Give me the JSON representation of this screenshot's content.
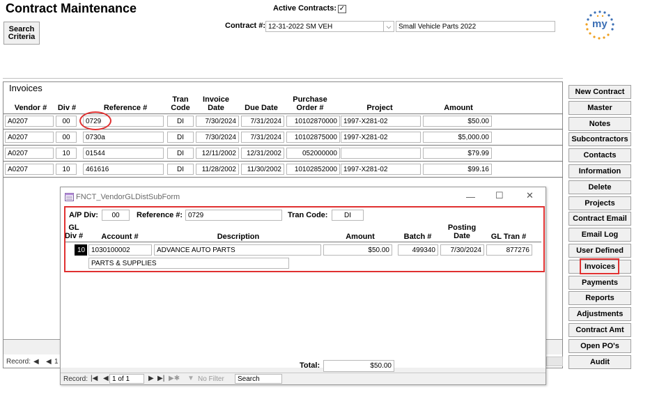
{
  "title": "Contract Maintenance",
  "search_criteria_label": "Search\nCriteria",
  "active_contracts_label": "Active Contracts:",
  "active_contracts_checked": "✓",
  "contract_label": "Contract #:",
  "contract_value": "12-31-2022 SM VEH",
  "contract_description": "Small Vehicle Parts 2022",
  "logo_text": "my",
  "invoices": {
    "section_title": "Invoices",
    "columns": {
      "vendor": "Vendor #",
      "div": "Div #",
      "reference": "Reference #",
      "tran_code": "Tran\nCode",
      "invoice_date": "Invoice\nDate",
      "due_date": "Due Date",
      "po": "Purchase\nOrder #",
      "project": "Project",
      "amount": "Amount"
    },
    "rows": [
      {
        "vendor": "A0207",
        "div": "00",
        "reference": "0729",
        "tran_code": "DI",
        "invoice_date": "7/30/2024",
        "due_date": "7/31/2024",
        "po": "10102870000",
        "project": "1997-X281-02",
        "amount": "$50.00"
      },
      {
        "vendor": "A0207",
        "div": "00",
        "reference": "0730a",
        "tran_code": "DI",
        "invoice_date": "7/30/2024",
        "due_date": "7/31/2024",
        "po": "10102875000",
        "project": "1997-X281-02",
        "amount": "$5,000.00"
      },
      {
        "vendor": "A0207",
        "div": "10",
        "reference": "01544",
        "tran_code": "DI",
        "invoice_date": "12/11/2002",
        "due_date": "12/31/2002",
        "po": "052000000",
        "project": "",
        "amount": "$79.99"
      },
      {
        "vendor": "A0207",
        "div": "10",
        "reference": "461616",
        "tran_code": "DI",
        "invoice_date": "11/28/2002",
        "due_date": "11/30/2002",
        "po": "10102852000",
        "project": "1997-X281-02",
        "amount": "$99.16"
      }
    ],
    "record_label": "Record:",
    "record_nav_partial": "1"
  },
  "sidebar": {
    "buttons": [
      "New Contract",
      "Master",
      "Notes",
      "Subcontractors",
      "Contacts",
      "Information",
      "Delete",
      "Projects",
      "Contract Email",
      "Email Log",
      "User Defined",
      "Invoices",
      "Payments",
      "Reports",
      "Adjustments",
      "Contract Amt",
      "Open PO's",
      "Audit"
    ]
  },
  "subform": {
    "title": "FNCT_VendorGLDistSubForm",
    "ap_div_label": "A/P Div:",
    "ap_div_value": "00",
    "reference_label": "Reference #:",
    "reference_value": "0729",
    "tran_code_label": "Tran Code:",
    "tran_code_value": "DI",
    "columns": {
      "gl_div": "GL\nDiv #",
      "account": "Account #",
      "description": "Description",
      "amount": "Amount",
      "batch": "Batch #",
      "posting_date": "Posting\nDate",
      "gl_tran": "GL Tran #"
    },
    "row": {
      "gl_div": "10",
      "account": "1030100002",
      "description": "ADVANCE AUTO PARTS",
      "amount": "$50.00",
      "batch": "499340",
      "posting_date": "7/30/2024",
      "gl_tran": "877276",
      "line2": "PARTS & SUPPLIES"
    },
    "total_label": "Total:",
    "total_value": "$50.00",
    "record_label": "Record:",
    "record_value": "1 of 1",
    "no_filter_label": "No Filter",
    "search_label": "Search"
  }
}
